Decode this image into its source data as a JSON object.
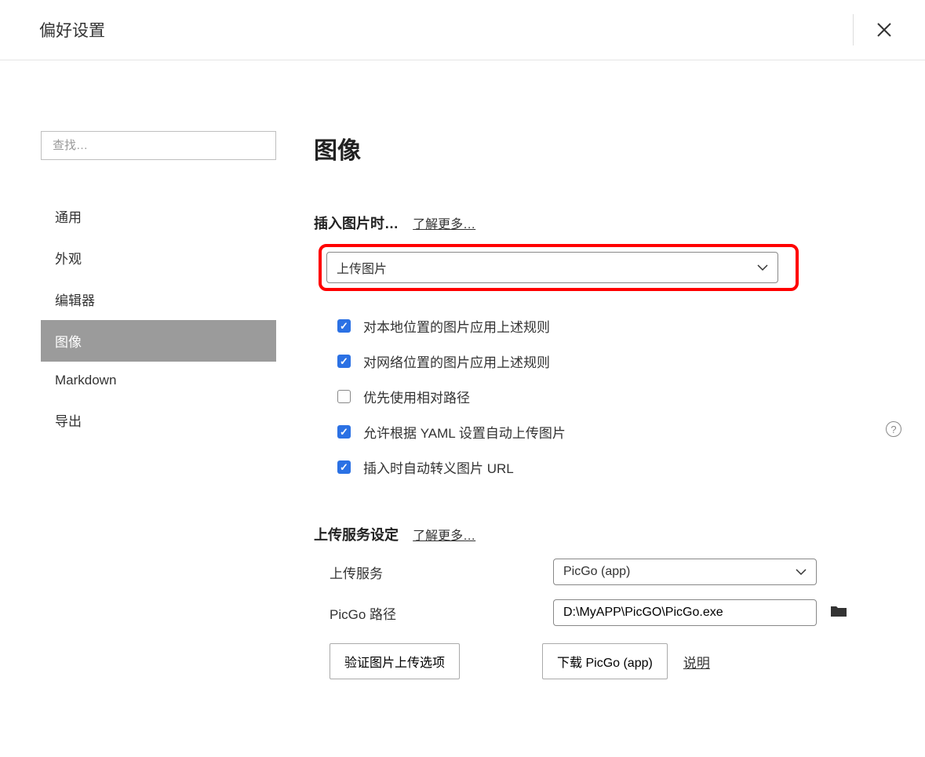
{
  "header": {
    "title": "偏好设置"
  },
  "sidebar": {
    "search_placeholder": "查找…",
    "items": [
      {
        "label": "通用"
      },
      {
        "label": "外观"
      },
      {
        "label": "编辑器"
      },
      {
        "label": "图像"
      },
      {
        "label": "Markdown"
      },
      {
        "label": "导出"
      }
    ],
    "active_index": 3
  },
  "main": {
    "title": "图像",
    "section1": {
      "header": "插入图片时…",
      "learn_more": "了解更多…",
      "select_value": "上传图片",
      "checkboxes": [
        {
          "checked": true,
          "label": "对本地位置的图片应用上述规则"
        },
        {
          "checked": true,
          "label": "对网络位置的图片应用上述规则"
        },
        {
          "checked": false,
          "label": "优先使用相对路径"
        },
        {
          "checked": true,
          "label": "允许根据 YAML 设置自动上传图片"
        },
        {
          "checked": true,
          "label": "插入时自动转义图片 URL"
        }
      ]
    },
    "section2": {
      "header": "上传服务设定",
      "learn_more": "了解更多…",
      "service_label": "上传服务",
      "service_value": "PicGo (app)",
      "path_label": "PicGo 路径",
      "path_value": "D:\\MyAPP\\PicGO\\PicGo.exe",
      "verify_button": "验证图片上传选项",
      "download_button": "下载 PicGo (app)",
      "info_link": "说明"
    }
  }
}
